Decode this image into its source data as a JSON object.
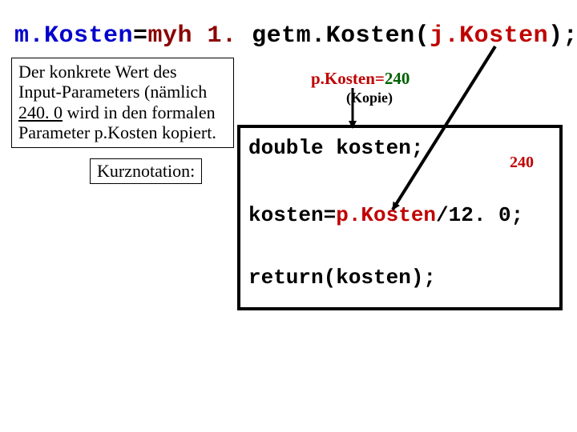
{
  "code_line": {
    "mk": "m.Kosten",
    "eq": "=",
    "obj": "myh 1.",
    "call": " getm.Kosten(",
    "jk": "j.Kosten",
    "tail": "); "
  },
  "desc": {
    "l1": "Der konkrete Wert des",
    "l2": "Input-Parameters (nämlich",
    "num": "240. 0",
    "l3_tail": " wird in den formalen",
    "l4": "Parameter p.Kosten kopiert."
  },
  "kurz": "Kurznotation:",
  "pkosten": {
    "label": "p.Kosten=",
    "val": "240"
  },
  "kopie": "(Kopie)",
  "codebox": {
    "l1": "double kosten;",
    "l2a": "kosten=",
    "l2b": "p.Kosten",
    "l2c": "/12. 0;",
    "l3": "return(kosten);"
  },
  "val240": "240"
}
